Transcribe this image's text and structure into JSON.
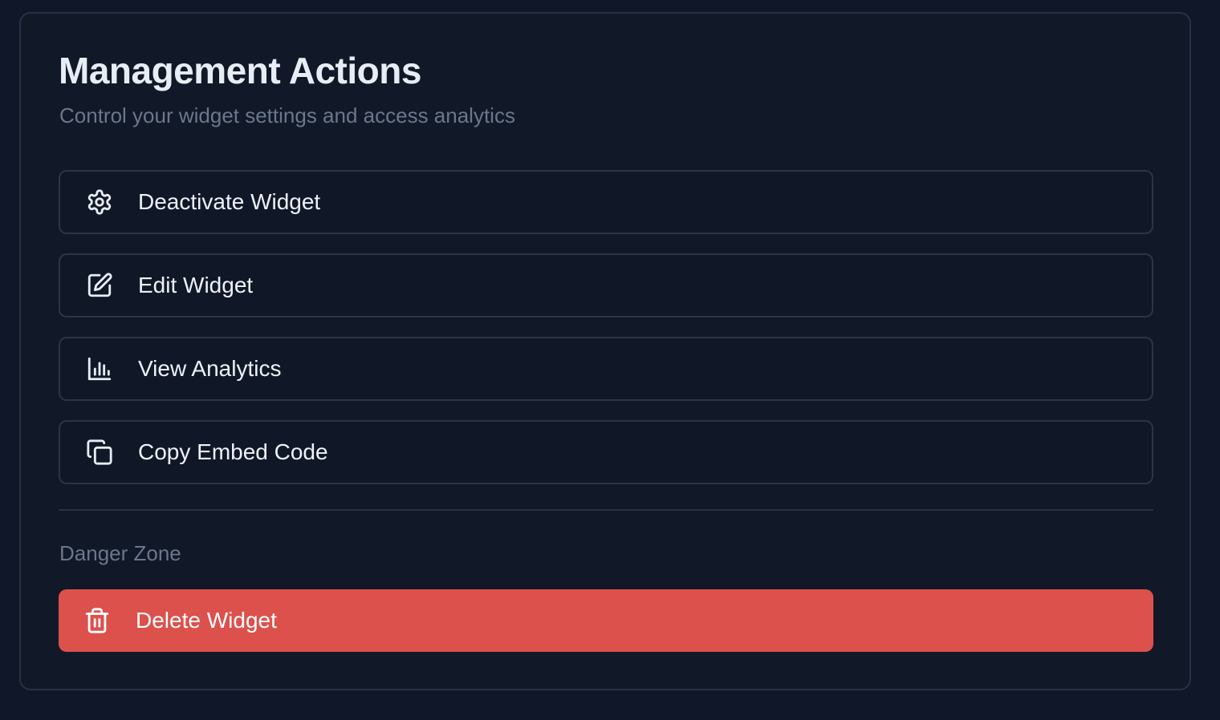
{
  "panel": {
    "title": "Management Actions",
    "subtitle": "Control your widget settings and access analytics"
  },
  "actions": [
    {
      "label": "Deactivate Widget",
      "icon": "gear-icon"
    },
    {
      "label": "Edit Widget",
      "icon": "edit-icon"
    },
    {
      "label": "View Analytics",
      "icon": "bar-chart-icon"
    },
    {
      "label": "Copy Embed Code",
      "icon": "copy-icon"
    }
  ],
  "danger": {
    "section_label": "Danger Zone",
    "delete_label": "Delete Widget",
    "icon": "trash-icon"
  },
  "colors": {
    "background": "#0f1729",
    "card": "#111827",
    "border": "#273244",
    "text": "#eef2f8",
    "muted": "#6b778c",
    "danger": "#dc514c"
  }
}
